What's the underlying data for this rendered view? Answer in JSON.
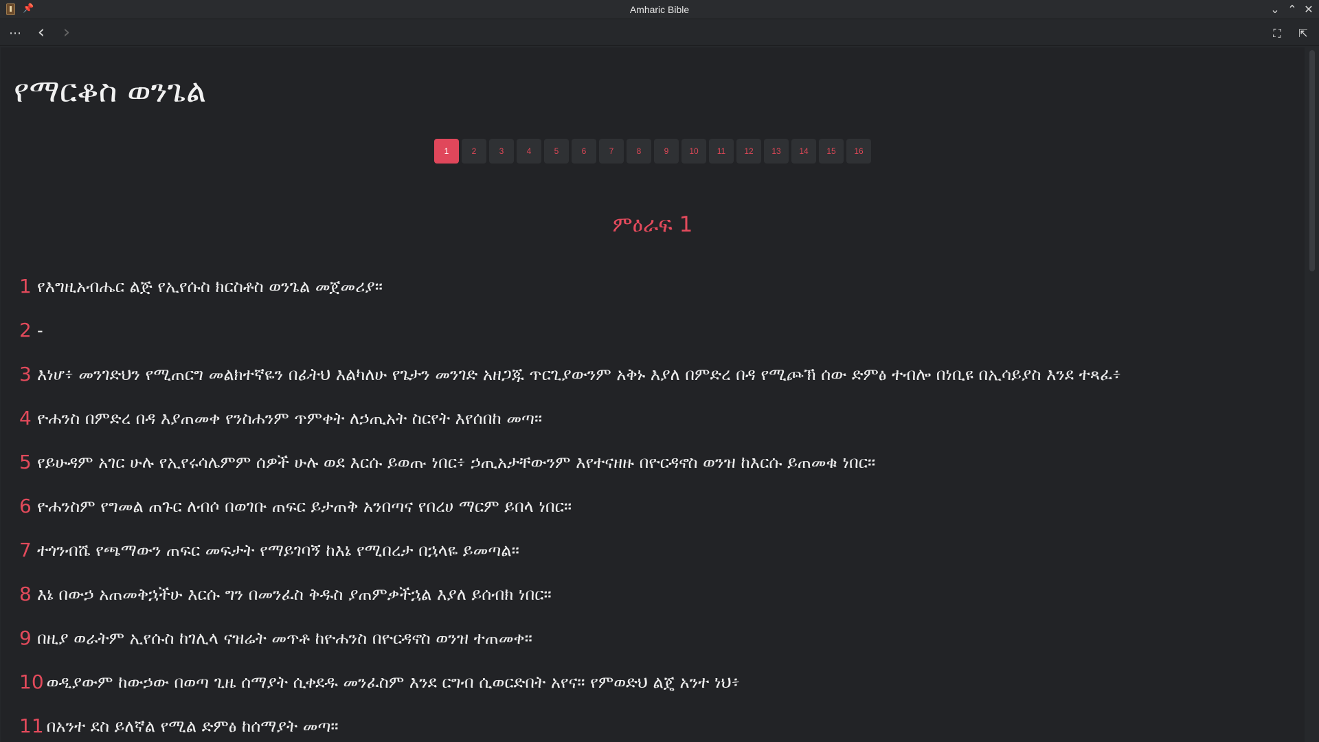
{
  "window": {
    "title": "Amharic Bible",
    "icons": {
      "app": "bible-app-icon",
      "pin": "pin-icon",
      "minimize": "chevron-down-icon",
      "maximize": "chevron-up-icon",
      "close": "close-icon"
    }
  },
  "toolbar": {
    "menu_icon": "⋯",
    "back_icon": "‹",
    "forward_icon": "›",
    "fit_icon": "⛶",
    "exit_fullscreen_icon": "⇱"
  },
  "book": {
    "title": "የማርቆስ ወንጌል",
    "chapter_heading": "ምዕራፍ 1"
  },
  "chapters": [
    "1",
    "2",
    "3",
    "4",
    "5",
    "6",
    "7",
    "8",
    "9",
    "10",
    "11",
    "12",
    "13",
    "14",
    "15",
    "16"
  ],
  "active_chapter": "1",
  "verses": [
    {
      "num": "1",
      "text": "የእግዚአብሔር ልጅ የኢየሱስ ክርስቶስ ወንጌል መጀመሪያ።"
    },
    {
      "num": "2",
      "text": "-"
    },
    {
      "num": "3",
      "text": "እነሆ፥ መንገድህን የሚጠርግ መልክተኛዬን በፊትህ እልካለሁ የጌታን መንገድ አዘጋጁ ጥርጊያውንም አቅኑ እያለ በምድረ በዳ የሚጮኽ ሰው ድምፅ ተብሎ በነቢዩ በኢሳይያስ እንደ ተጻፈ፥"
    },
    {
      "num": "4",
      "text": "ዮሐንስ በምድረ በዳ እያጠመቀ የንስሐንም ጥምቀት ለኃጢአት ስርየት እየሰበከ መጣ።"
    },
    {
      "num": "5",
      "text": "የይሁዳም አገር ሁሉ የኢየሩሳሌምም ሰዎች ሁሉ ወደ እርሱ ይወጡ ነበር፥ ኃጢአታቸውንም እየተናዘዙ በዮርዳኖስ ወንዝ ከእርሱ ይጠመቁ ነበር።"
    },
    {
      "num": "6",
      "text": "ዮሐንስም የግመል ጠጉር ለብሶ በወገቡ ጠፍር ይታጠቅ አንበጣና የበረሀ ማርም ይበላ ነበር።"
    },
    {
      "num": "7",
      "text": "ተጎንብሼ የጫማውን ጠፍር መፍታት የማይገባኝ ከእኔ የሚበረታ በኋላዬ ይመጣል።"
    },
    {
      "num": "8",
      "text": "እኔ በውኃ አጠመቅኋችሁ እርሱ ግን በመንፈስ ቅዱስ ያጠምቃችኋል እያለ ይሰብክ ነበር።"
    },
    {
      "num": "9",
      "text": "በዚያ ወራትም ኢየሱስ ከገሊላ ናዝሬት መጥቶ ከዮሐንስ በዮርዳኖስ ወንዝ ተጠመቀ።"
    },
    {
      "num": "10",
      "text": "ወዲያውም ከውኃው በወጣ ጊዜ ሰማያት ሲቀደዱ መንፈስም እንደ ርግብ ሲወርድበት አየና። የምወድህ ልጄ አንተ ነህ፥"
    },
    {
      "num": "11",
      "text": "በአንተ ደስ ይለኛል የሚል ድምፅ ከሰማያት መጣ።"
    }
  ],
  "colors": {
    "accent": "#e0475b",
    "background": "#222326",
    "text": "#ececec"
  }
}
